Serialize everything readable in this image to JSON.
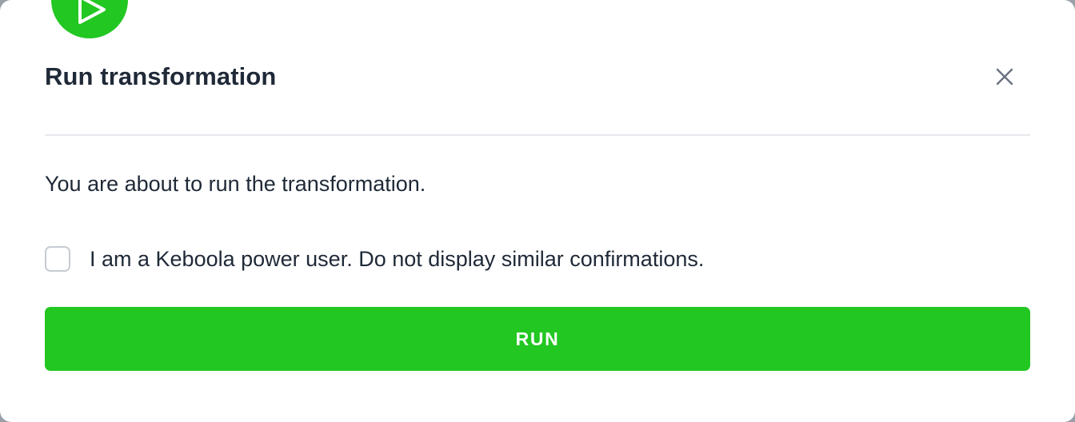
{
  "modal": {
    "title": "Run transformation",
    "message": "You are about to run the transformation.",
    "checkbox_label": "I am a Keboola power user. Do not display similar confirmations.",
    "checkbox_checked": false,
    "run_button_label": "RUN"
  },
  "icons": {
    "header": "play-icon",
    "close": "close-icon"
  },
  "colors": {
    "accent": "#22c722",
    "text": "#1f2937",
    "divider": "#e7e9ec"
  }
}
